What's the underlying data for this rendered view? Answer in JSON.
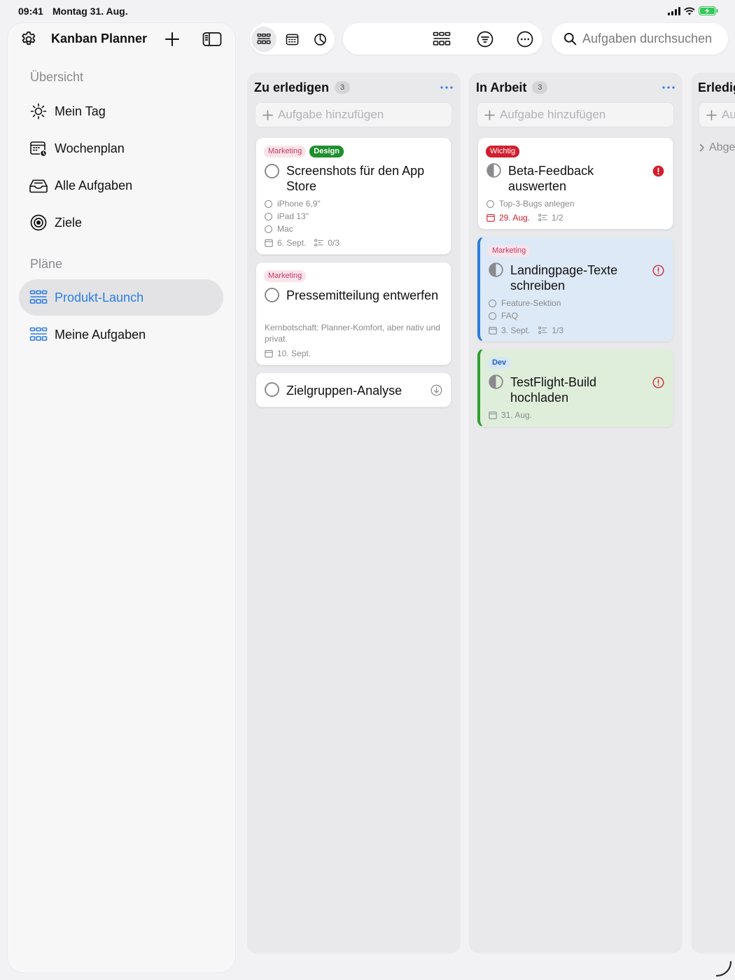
{
  "status": {
    "time": "09:41",
    "date": "Montag 31. Aug."
  },
  "sidebar": {
    "app_title": "Kanban Planner",
    "overview_title": "Übersicht",
    "overview_items": [
      {
        "label": "Mein Tag",
        "icon": "sun-icon"
      },
      {
        "label": "Wochenplan",
        "icon": "calendar-week-icon"
      },
      {
        "label": "Alle Aufgaben",
        "icon": "tray-icon"
      },
      {
        "label": "Ziele",
        "icon": "target-icon"
      }
    ],
    "plans_title": "Pläne",
    "plans": [
      {
        "label": "Produkt-Launch",
        "icon": "board-grid-icon",
        "active": true
      },
      {
        "label": "Meine Aufgaben",
        "icon": "board-grid-icon",
        "active": false
      }
    ]
  },
  "search": {
    "placeholder": "Aufgaben durchsuchen"
  },
  "colors": {
    "accent": "#2b7de3",
    "danger": "#d21f2e",
    "success": "#2ea12e"
  },
  "columns": [
    {
      "title": "Zu erledigen",
      "count": "3",
      "add_label": "Aufgabe hinzufügen",
      "cards": [
        {
          "tags": [
            "Marketing",
            "Design"
          ],
          "title": "Screenshots für den App Store",
          "subtasks": [
            "iPhone 6,9\"",
            "iPad 13\"",
            "Mac"
          ],
          "date": "6. Sept.",
          "checklist": "0/3"
        },
        {
          "tags": [
            "Marketing"
          ],
          "title": "Pressemitteilung entwerfen",
          "description": "Kernbotschaft: Planner-Komfort, aber nativ und privat.",
          "date": "10. Sept."
        },
        {
          "title": "Zielgruppen-Analyse"
        }
      ]
    },
    {
      "title": "In Arbeit",
      "count": "3",
      "add_label": "Aufgabe hinzufügen",
      "cards": [
        {
          "tags": [
            "Wichtig"
          ],
          "title": "Beta-Feedback auswerten",
          "subtasks": [
            "Top-3-Bugs anlegen"
          ],
          "date": "29. Aug.",
          "checklist": "1/2"
        },
        {
          "tags": [
            "Marketing"
          ],
          "title": "Landingpage-Texte schreiben",
          "subtasks": [
            "Feature-Sektion",
            "FAQ"
          ],
          "date": "3. Sept.",
          "checklist": "1/3"
        },
        {
          "tags": [
            "Dev"
          ],
          "title": "TestFlight-Build hochladen",
          "date": "31. Aug."
        }
      ]
    },
    {
      "title": "Erledigt",
      "add_label": "Aufgabe hinzufügen",
      "collapsed_label": "Abgeschlossen"
    }
  ]
}
